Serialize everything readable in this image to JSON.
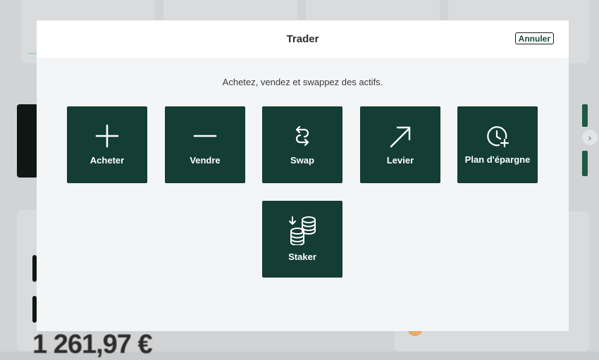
{
  "modal": {
    "title": "Trader",
    "cancel_label": "Annuler",
    "subtitle": "Achetez, vendez et swappez des actifs.",
    "actions": [
      {
        "label": "Acheter",
        "icon": "plus-icon"
      },
      {
        "label": "Vendre",
        "icon": "minus-icon"
      },
      {
        "label": "Swap",
        "icon": "swap-arrows-icon"
      },
      {
        "label": "Levier",
        "icon": "arrow-up-right-icon"
      },
      {
        "label": "Plan d'épargne",
        "icon": "clock-plus-icon"
      },
      {
        "label": "Staker",
        "icon": "coin-stack-icon"
      }
    ]
  },
  "background": {
    "balance_text": "1 261,97 €"
  },
  "colors": {
    "tile": "#133d35",
    "modal_bg": "#f4f5f7",
    "header_bg": "#ffffff",
    "overlay": "#c9cacb"
  }
}
